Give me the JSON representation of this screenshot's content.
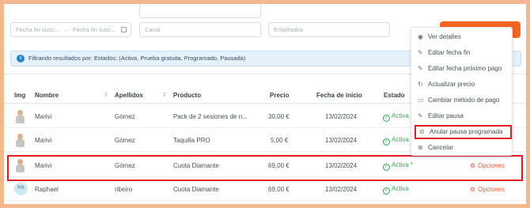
{
  "filters": {
    "fecha_fin_from": "Fecha fin susc...",
    "arrow": "→",
    "fecha_fin_to": "Fecha fin susc...",
    "canal": "Canal",
    "empleados": "Empleados"
  },
  "banner": {
    "icon": "i",
    "text": "Filtrando resultados por: Estados: (Activa, Prueba gratuita, Programado, Pausada)"
  },
  "table": {
    "headers": {
      "img": "Img",
      "nombre": "Nombre",
      "apellidos": "Apellidos",
      "producto": "Producto",
      "precio": "Precio",
      "fecha_inicio": "Fecha de inicio",
      "estado": "Estado"
    },
    "rows": [
      {
        "nombre": "Marivi",
        "apellidos": "Gómez",
        "producto": "Pack de 2 sesiones de n...",
        "precio": "30,00 €",
        "fecha": "13/02/2024",
        "estado": "Activa",
        "opciones": ""
      },
      {
        "nombre": "Marivi",
        "apellidos": "Gómez",
        "producto": "Taquilla PRO",
        "precio": "5,00 €",
        "fecha": "13/02/2024",
        "estado": "Activa",
        "opciones": ""
      },
      {
        "nombre": "Marivi",
        "apellidos": "Gómez",
        "producto": "Cuota Diamante",
        "precio": "69,00 €",
        "fecha": "13/02/2024",
        "estado": "Activa *",
        "opciones": "Opciones"
      },
      {
        "nombre": "Raphael",
        "apellidos": "ribeiro",
        "producto": "Cuota Diamante",
        "precio": "69,00 €",
        "fecha": "13/02/2024",
        "estado": "Activa",
        "opciones": "Opciones",
        "initials": "RR"
      }
    ]
  },
  "menu": {
    "items": [
      {
        "label": "Ver detalles",
        "icon": "◉"
      },
      {
        "label": "Editar fecha fin",
        "icon": "✎"
      },
      {
        "label": "Editar fecha próximo pago",
        "icon": "✎"
      },
      {
        "label": "Actualizar precio",
        "icon": "↻"
      },
      {
        "label": "Cambiar método de pago",
        "icon": "▭"
      },
      {
        "label": "Editar pausa",
        "icon": "✎"
      },
      {
        "label": "Anular pausa programada",
        "icon": "⊘"
      },
      {
        "label": "Cancelar",
        "icon": "⊗"
      }
    ]
  },
  "colors": {
    "accent": "#f4661f",
    "highlight": "#e31b23",
    "status_active": "#2fa84f",
    "frame": "#f3b88f"
  }
}
